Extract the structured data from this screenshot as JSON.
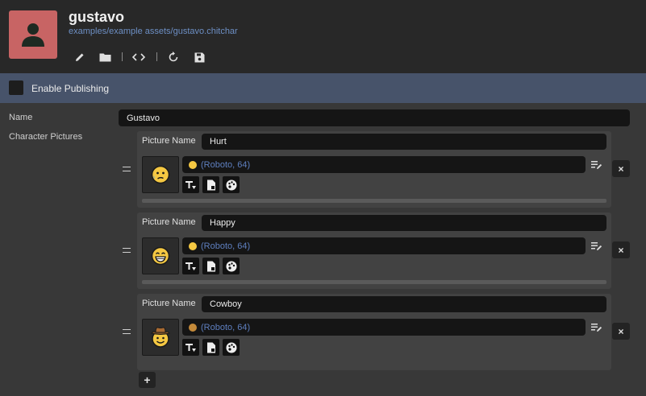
{
  "header": {
    "title": "gustavo",
    "path": "examples/example assets/gustavo.chitchar",
    "avatar_color": "#c86464",
    "toolbar_icons": [
      "pencil-icon",
      "folder-icon",
      "code-icon",
      "refresh-icon",
      "save-icon"
    ]
  },
  "publish": {
    "label": "Enable Publishing",
    "checked": false
  },
  "form": {
    "name_label": "Name",
    "name_value": "Gustavo",
    "pictures_label": "Character Pictures",
    "pictures": [
      {
        "label": "Picture Name",
        "name": "Hurt",
        "emoji_ref": "(Roboto, 64)"
      },
      {
        "label": "Picture Name",
        "name": "Happy",
        "emoji_ref": "(Roboto, 64)"
      },
      {
        "label": "Picture Name",
        "name": "Cowboy",
        "emoji_ref": "(Roboto, 64)"
      }
    ],
    "remove_label": "×",
    "add_label": "+"
  },
  "colors": {
    "accent_bar": "#47536a",
    "link": "#6d8fc4"
  }
}
